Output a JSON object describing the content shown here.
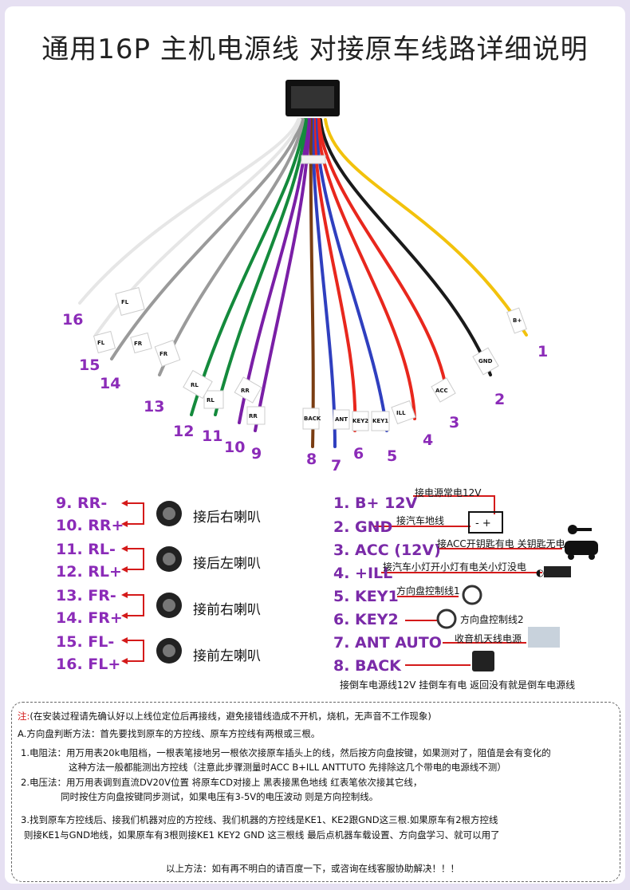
{
  "title": "通用16P 主机电源线 对接原车线路详细说明",
  "pin_numbers": [
    "1",
    "2",
    "3",
    "4",
    "5",
    "6",
    "7",
    "8",
    "9",
    "10",
    "11",
    "12",
    "13",
    "14",
    "15",
    "16"
  ],
  "wire_tags": [
    "B+",
    "GND",
    "ACC",
    "ILL",
    "KEY1",
    "KEY2",
    "ANT",
    "BACK",
    "RR",
    "RR",
    "RL",
    "RL",
    "FR",
    "FR",
    "FL",
    "FL"
  ],
  "speakers": [
    {
      "minus": "9.  RR-",
      "plus": "10. RR+",
      "label": "接后右喇叭"
    },
    {
      "minus": "11. RL-",
      "plus": "12. RL+",
      "label": "接后左喇叭"
    },
    {
      "minus": "13. FR-",
      "plus": "14. FR+",
      "label": "接前右喇叭"
    },
    {
      "minus": "15. FL-",
      "plus": "16. FL+",
      "label": "接前左喇叭"
    }
  ],
  "functions": [
    {
      "name": "1. B+ 12V",
      "desc": "接电源常电12V"
    },
    {
      "name": "2. GND",
      "desc": "接汽车地线"
    },
    {
      "name": "3. ACC (12V)",
      "desc": "接ACC开钥匙有电 关钥匙无电"
    },
    {
      "name": "4. +ILL",
      "desc": "接汽车小灯开小灯有电关小灯没电"
    },
    {
      "name": "5. KEY1",
      "desc": "方向盘控制线1"
    },
    {
      "name": "6. KEY2",
      "desc": "方向盘控制线2"
    },
    {
      "name": "7. ANT AUTO",
      "desc": "收音机天线电源"
    },
    {
      "name": "8. BACK",
      "desc": "接倒车电源线12V 挂倒车有电  返回没有就是倒车电源线"
    }
  ],
  "notes": {
    "head_red": "注:",
    "head": "(在安装过程请先确认好以上线位定位后再接线，避免接错线造成不开机，烧机，无声音不工作现象)",
    "a": "A.方向盘判断方法：首先要找到原车的方控线、原车方控线有两根或三根。",
    "r1": "1.电阻法：用万用表20k电阻档，一根表笔接地另一根依次接原车插头上的线，然后按方向盘按键，如果测对了，阻值是会有变化的",
    "r2": "这种方法一般都能测出方控线（注意此步骤测量时ACC B+ILL  ANTTUTO 先排除这几个带电的电源线不测）",
    "v1": "2.电压法：用万用表调到直流DV20V位置 将原车CD对接上 黑表接黑色地线 红表笔依次接其它线，",
    "v2": "同时按住方向盘按键同步测试，如果电压有3-5V的电压波动 则是方向控制线。",
    "s1": "3.找到原车方控线后、接我们机器对应的方控线、我们机器的方控线是KE1、KE2跟GND这三根.如果原车有2根方控线",
    "s2": "则接KE1与GND地线，如果原车有3根则接KE1 KEY2 GND 这三根线 最后点机器车载设置、方向盘学习、就可以用了",
    "end": "以上方法：如有再不明白的请百度一下，或咨询在线客服协助解决！！！"
  },
  "colors": {
    "accent": "#8b2bb8",
    "arrow": "#d41a1a",
    "wire_yellow": "#f2c20c",
    "wire_red": "#e8271d",
    "wire_black": "#1a1a1a",
    "wire_blue": "#2f3fbf",
    "wire_green": "#148a3c",
    "wire_purple": "#7a1fa6",
    "wire_gray": "#9a9a9a",
    "wire_brown": "#7a3d12",
    "wire_orange": "#f07a1a"
  }
}
